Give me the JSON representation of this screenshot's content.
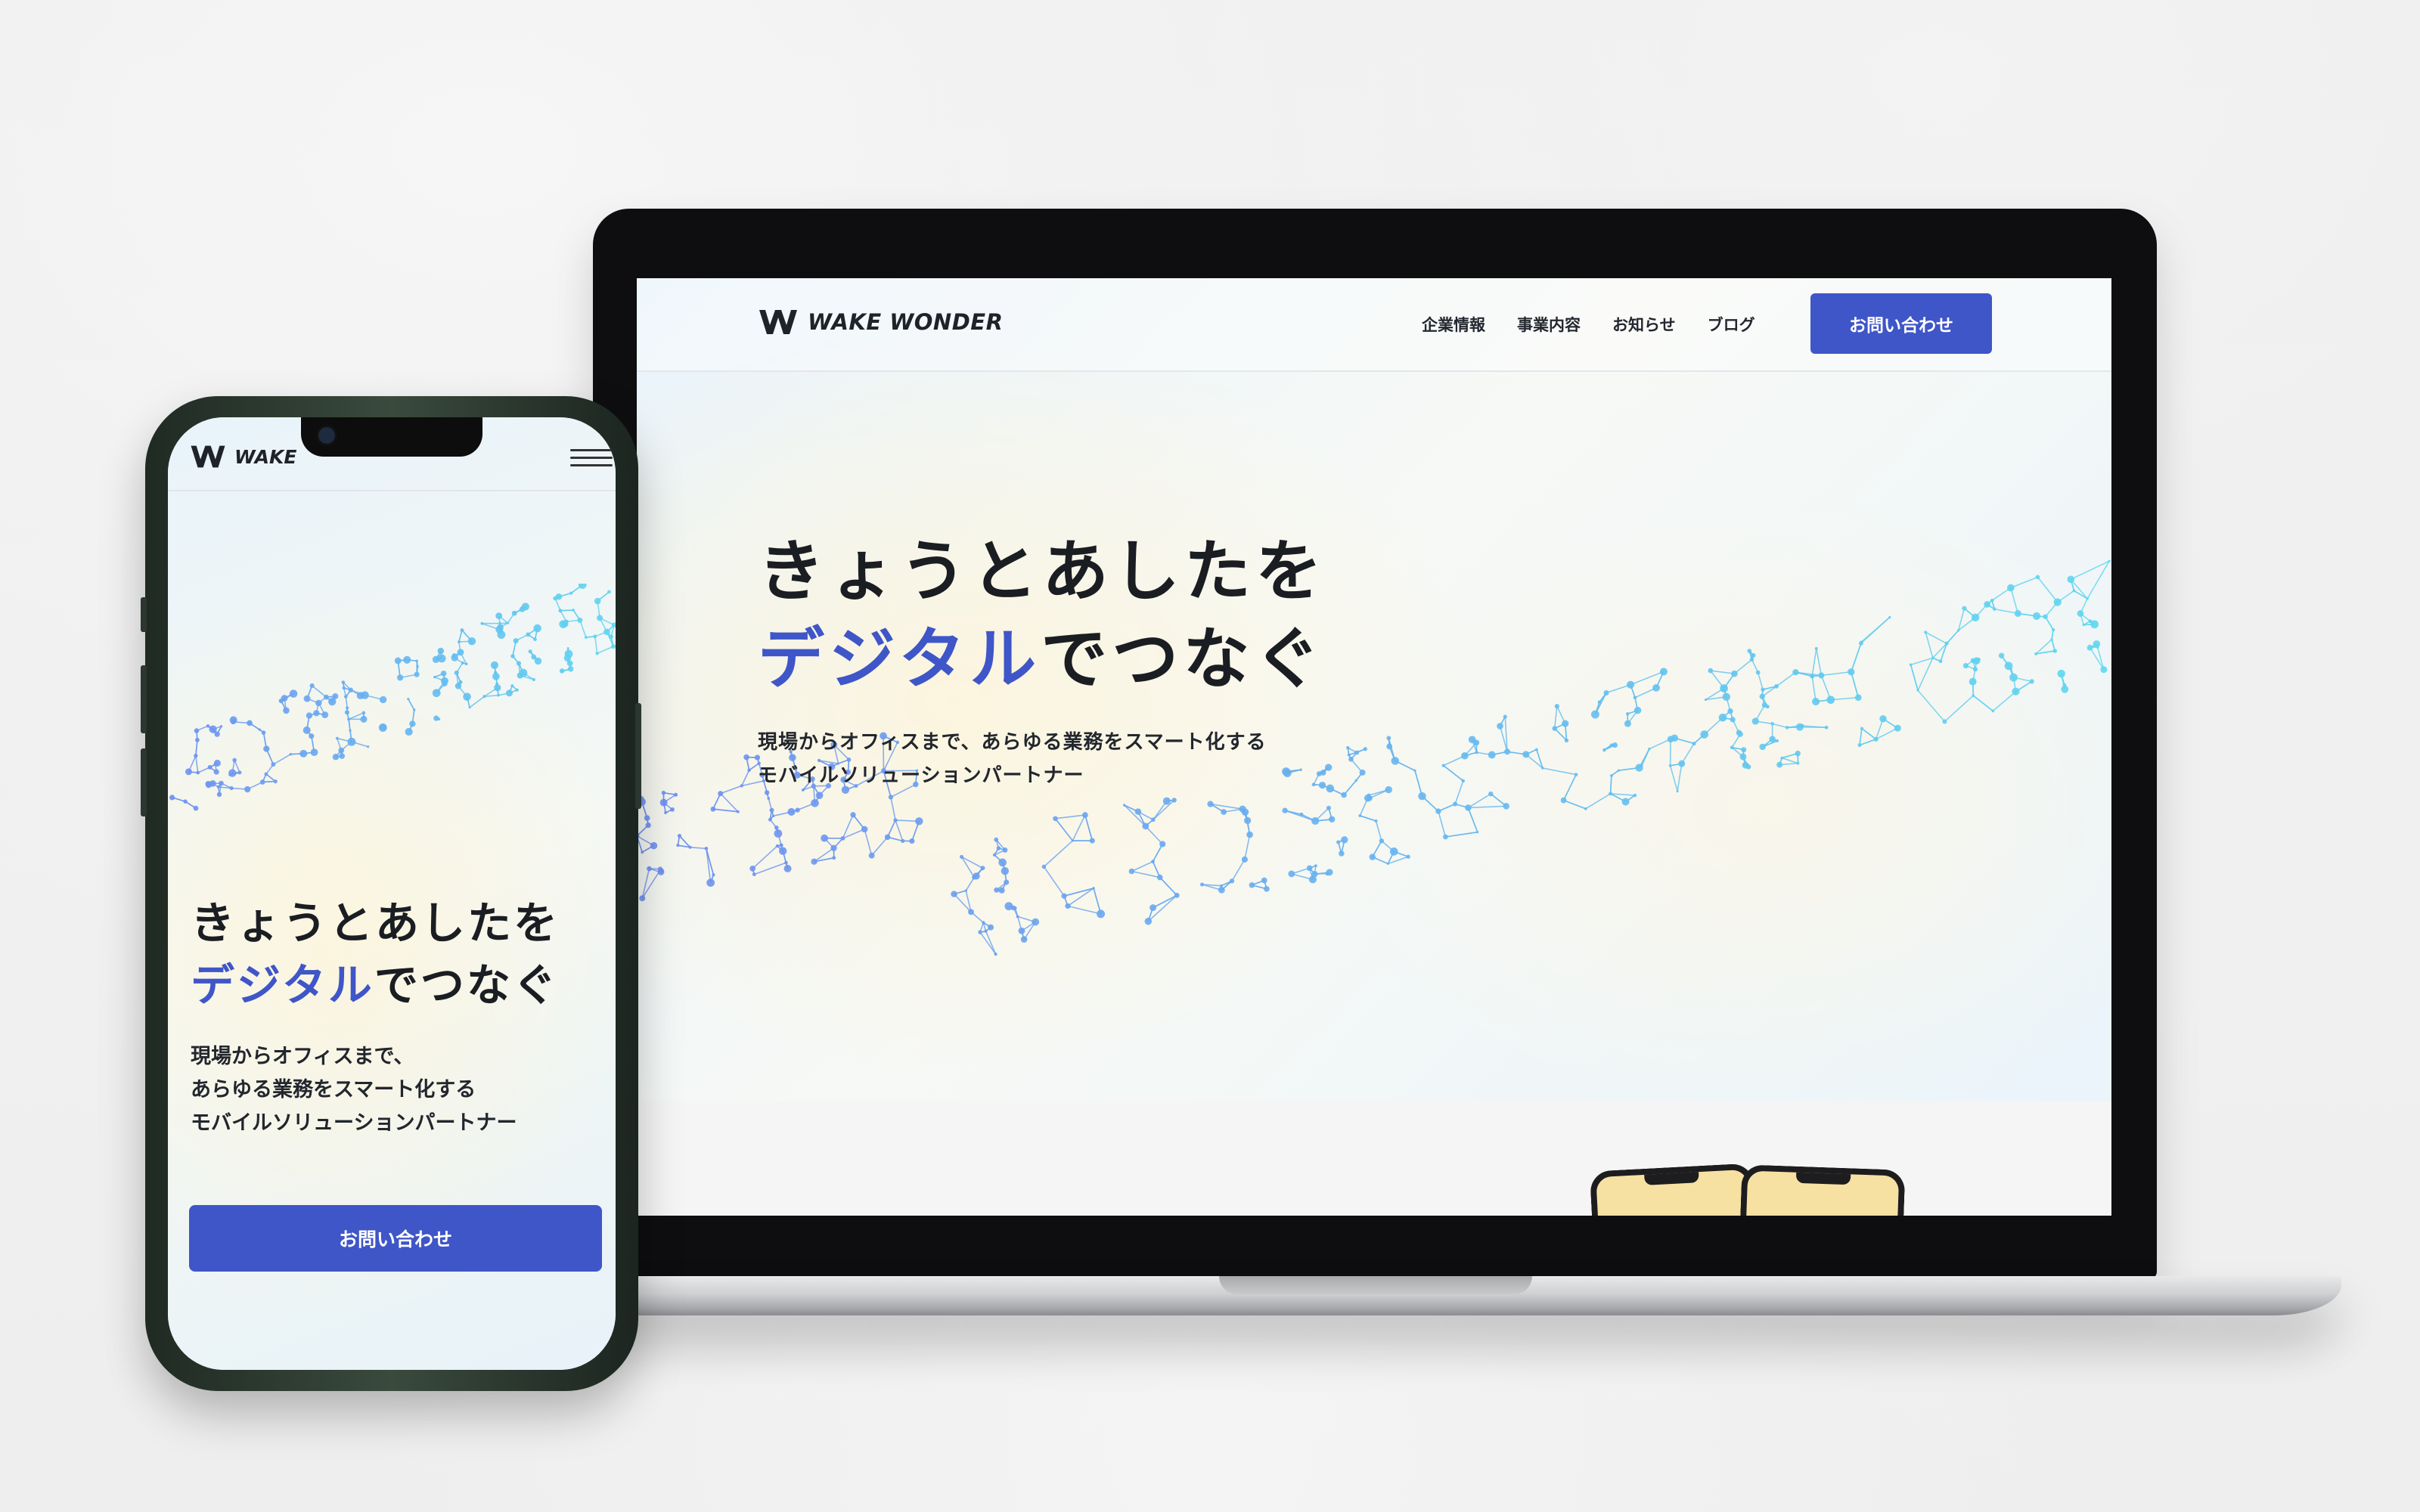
{
  "brand": {
    "name": "WAKE WONDER",
    "phone_name": "WAKE"
  },
  "nav": {
    "items": [
      "企業情報",
      "事業内容",
      "お知らせ",
      "ブログ"
    ],
    "cta_label": "お問い合わせ"
  },
  "hero": {
    "title_line1": "きょうとあしたを",
    "title_line2_blue": "デジタル",
    "title_line2_rest": "でつなぐ",
    "subtitle_line1": "現場からオフィスまで、あらゆる業務をスマート化する",
    "subtitle_line2": "モバイルソリューションパートナー"
  },
  "mobile": {
    "subtitle_line1": "現場からオフィスまで、",
    "subtitle_line2": "あらゆる業務をスマート化する",
    "subtitle_line3": "モバイルソリューションパートナー",
    "cta_label": "お問い合わせ"
  },
  "colors": {
    "accent": "#3f56c8",
    "text": "#1a1d22",
    "network_start": "#6f8ff0",
    "network_end": "#5fd8f0"
  },
  "icons": {
    "logo": "wake-wonder-logo-icon",
    "menu": "hamburger-menu-icon"
  }
}
